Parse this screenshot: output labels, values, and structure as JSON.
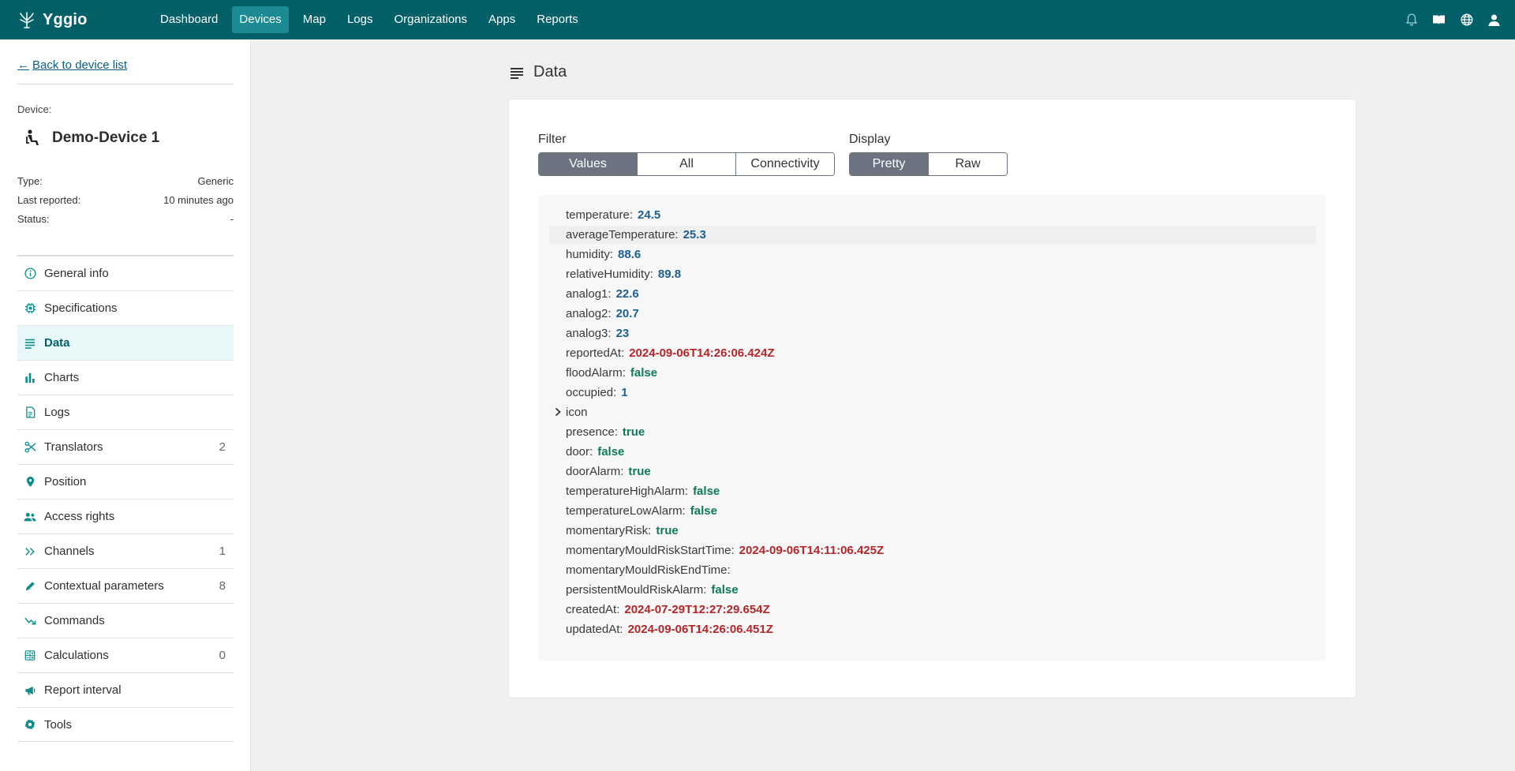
{
  "brand": {
    "name": "Yggio"
  },
  "nav": [
    {
      "label": "Dashboard",
      "active": false
    },
    {
      "label": "Devices",
      "active": true
    },
    {
      "label": "Map",
      "active": false
    },
    {
      "label": "Logs",
      "active": false
    },
    {
      "label": "Organizations",
      "active": false
    },
    {
      "label": "Apps",
      "active": false
    },
    {
      "label": "Reports",
      "active": false
    }
  ],
  "top_icons": [
    "bell-icon",
    "book-icon",
    "globe-icon",
    "user-icon"
  ],
  "sidebar": {
    "back_label": "Back to device list",
    "device_label": "Device:",
    "device_name": "Demo-Device 1",
    "device_icon": "person-seated-icon",
    "meta": [
      {
        "key": "Type:",
        "value": "Generic"
      },
      {
        "key": "Last reported:",
        "value": "10 minutes ago"
      },
      {
        "key": "Status:",
        "value": "-"
      }
    ],
    "menu": [
      {
        "label": "General info",
        "icon": "info-icon",
        "count": "",
        "active": false
      },
      {
        "label": "Specifications",
        "icon": "chip-icon",
        "count": "",
        "active": false
      },
      {
        "label": "Data",
        "icon": "lines-icon",
        "count": "",
        "active": true
      },
      {
        "label": "Charts",
        "icon": "bar-chart-icon",
        "count": "",
        "active": false
      },
      {
        "label": "Logs",
        "icon": "document-icon",
        "count": "",
        "active": false
      },
      {
        "label": "Translators",
        "icon": "scissors-icon",
        "count": "2",
        "active": false
      },
      {
        "label": "Position",
        "icon": "pin-icon",
        "count": "",
        "active": false
      },
      {
        "label": "Access rights",
        "icon": "people-icon",
        "count": "",
        "active": false
      },
      {
        "label": "Channels",
        "icon": "double-chevron-icon",
        "count": "1",
        "active": false
      },
      {
        "label": "Contextual parameters",
        "icon": "pencil-icon",
        "count": "8",
        "active": false
      },
      {
        "label": "Commands",
        "icon": "trend-icon",
        "count": "",
        "active": false
      },
      {
        "label": "Calculations",
        "icon": "calculator-icon",
        "count": "0",
        "active": false
      },
      {
        "label": "Report interval",
        "icon": "megaphone-icon",
        "count": "",
        "active": false
      },
      {
        "label": "Tools",
        "icon": "gear-icon",
        "count": "",
        "active": false
      }
    ]
  },
  "main": {
    "title": "Data",
    "filter": {
      "label": "Filter",
      "options": [
        "Values",
        "All",
        "Connectivity"
      ],
      "selected": "Values"
    },
    "display": {
      "label": "Display",
      "options": [
        "Pretty",
        "Raw"
      ],
      "selected": "Pretty"
    },
    "rows": [
      {
        "key": "temperature:",
        "value": "24.5",
        "type": "num"
      },
      {
        "key": "averageTemperature:",
        "value": "25.3",
        "type": "num",
        "hl": true
      },
      {
        "key": "humidity:",
        "value": "88.6",
        "type": "num"
      },
      {
        "key": "relativeHumidity:",
        "value": "89.8",
        "type": "num"
      },
      {
        "key": "analog1:",
        "value": "22.6",
        "type": "num"
      },
      {
        "key": "analog2:",
        "value": "20.7",
        "type": "num"
      },
      {
        "key": "analog3:",
        "value": "23",
        "type": "num"
      },
      {
        "key": "reportedAt:",
        "value": "2024-09-06T14:26:06.424Z",
        "type": "str"
      },
      {
        "key": "floodAlarm:",
        "value": "false",
        "type": "bool"
      },
      {
        "key": "occupied:",
        "value": "1",
        "type": "num"
      },
      {
        "key": "icon",
        "value": "",
        "type": "obj",
        "collapsible": true
      },
      {
        "key": "presence:",
        "value": "true",
        "type": "bool"
      },
      {
        "key": "door:",
        "value": "false",
        "type": "bool"
      },
      {
        "key": "doorAlarm:",
        "value": "true",
        "type": "bool"
      },
      {
        "key": "temperatureHighAlarm:",
        "value": "false",
        "type": "bool"
      },
      {
        "key": "temperatureLowAlarm:",
        "value": "false",
        "type": "bool"
      },
      {
        "key": "momentaryRisk:",
        "value": "true",
        "type": "bool"
      },
      {
        "key": "momentaryMouldRiskStartTime:",
        "value": "2024-09-06T14:11:06.425Z",
        "type": "str"
      },
      {
        "key": "momentaryMouldRiskEndTime:",
        "value": "",
        "type": "str"
      },
      {
        "key": "persistentMouldRiskAlarm:",
        "value": "false",
        "type": "bool"
      },
      {
        "key": "createdAt:",
        "value": "2024-07-29T12:27:29.654Z",
        "type": "str"
      },
      {
        "key": "updatedAt:",
        "value": "2024-09-06T14:26:06.451Z",
        "type": "str"
      }
    ]
  },
  "colors": {
    "topbar": "#036069",
    "nav_active": "#1b8a92",
    "accent": "#0e8c8c",
    "number": "#1d5f8f",
    "string": "#b3262a",
    "boolean": "#0f7a5a"
  }
}
